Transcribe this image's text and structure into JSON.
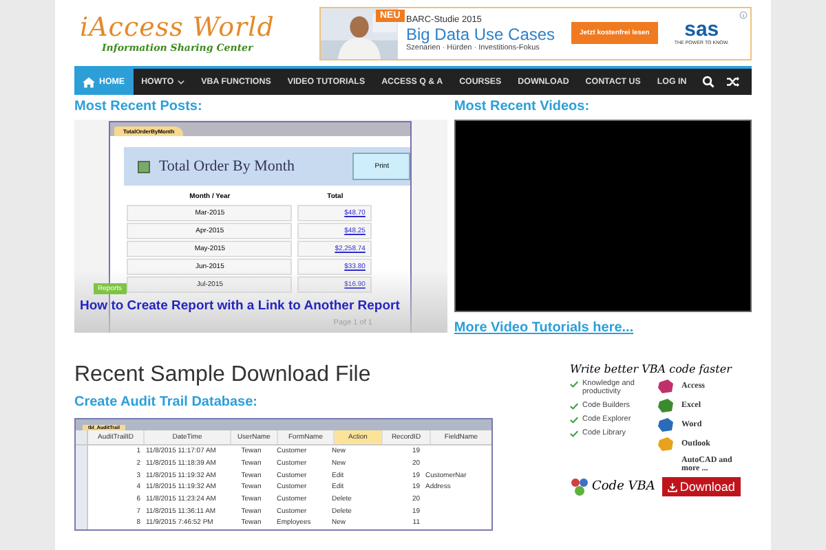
{
  "header": {
    "logo": {
      "title": "iAccess World",
      "tagline": "Information Sharing Center"
    },
    "ad": {
      "badge": "NEU",
      "eyebrow": "BARC-Studie 2015",
      "headline": "Big Data Use Cases",
      "subline": "Szenarien · Hürden · Investitions-Fokus",
      "cta": "Jetzt kostenfrei lesen",
      "brand": "sas",
      "brand_tagline": "THE POWER TO KNOW."
    }
  },
  "nav": {
    "items": [
      {
        "label": "HOME",
        "kind": "home",
        "dropdown": false,
        "selected": true
      },
      {
        "label": "HOWTO",
        "kind": "link",
        "dropdown": true,
        "selected": false
      },
      {
        "label": "VBA FUNCTIONS",
        "kind": "link",
        "dropdown": false,
        "selected": false
      },
      {
        "label": "VIDEO TUTORIALS",
        "kind": "link",
        "dropdown": false,
        "selected": false
      },
      {
        "label": "ACCESS Q & A",
        "kind": "link",
        "dropdown": false,
        "selected": false
      },
      {
        "label": "COURSES",
        "kind": "link",
        "dropdown": false,
        "selected": false
      },
      {
        "label": "DOWNLOAD",
        "kind": "link",
        "dropdown": false,
        "selected": false
      },
      {
        "label": "CONTACT US",
        "kind": "link",
        "dropdown": false,
        "selected": false
      },
      {
        "label": "LOG IN",
        "kind": "link",
        "dropdown": false,
        "selected": false
      }
    ]
  },
  "recent_posts": {
    "heading": "Most Recent Posts:",
    "post": {
      "category": "Reports",
      "title": "How to Create Report with a Link to Another Report",
      "report": {
        "tab": "TotalOrderByMonth",
        "title": "Total Order By Month",
        "button": "Print",
        "columns": [
          "Month / Year",
          "Total"
        ],
        "rows": [
          [
            "Mar-2015",
            "$48.70"
          ],
          [
            "Apr-2015",
            "$48.25"
          ],
          [
            "May-2015",
            "$2,258.74"
          ],
          [
            "Jun-2015",
            "$33.80"
          ],
          [
            "Jul-2015",
            "$16.90"
          ]
        ],
        "footer": "Page 1 of 1"
      }
    }
  },
  "recent_videos": {
    "heading": "Most Recent Videos:",
    "more_link": "More Video Tutorials here..."
  },
  "download": {
    "heading": "Recent Sample Download File",
    "subheading": "Create Audit Trail Database:",
    "table": {
      "tab": "tbl_AuditTrail",
      "columns": [
        {
          "label": "AuditTrailID",
          "selected": false
        },
        {
          "label": "DateTime",
          "selected": false
        },
        {
          "label": "UserName",
          "selected": false
        },
        {
          "label": "FormName",
          "selected": false
        },
        {
          "label": "Action",
          "selected": true
        },
        {
          "label": "RecordID",
          "selected": false
        },
        {
          "label": "FieldName",
          "selected": false
        }
      ],
      "rows": [
        [
          "1",
          "11/8/2015 11:17:07 AM",
          "Tewan",
          "Customer",
          "New",
          "19"
        ],
        [
          "2",
          "11/8/2015 11:18:39 AM",
          "Tewan",
          "Customer",
          "New",
          "20"
        ],
        [
          "3",
          "11/8/2015 11:19:32 AM",
          "Tewan",
          "Customer",
          "Edit",
          "19",
          "CustomerNar"
        ],
        [
          "4",
          "11/8/2015 11:19:32 AM",
          "Tewan",
          "Customer",
          "Edit",
          "19",
          "Address"
        ],
        [
          "6",
          "11/8/2015 11:23:24 AM",
          "Tewan",
          "Customer",
          "Delete",
          "20"
        ],
        [
          "7",
          "11/8/2015 11:36:11 AM",
          "Tewan",
          "Customer",
          "Delete",
          "19"
        ],
        [
          "8",
          "11/9/2015 7:46:52 PM",
          "Tewan",
          "Employees",
          "New",
          "11"
        ]
      ]
    }
  },
  "sidebar_ad": {
    "title": "Write better VBA code faster",
    "features": [
      "Knowledge and productivity",
      "Code Builders",
      "Code Explorer",
      "Code Library"
    ],
    "apps": [
      {
        "name": "Access",
        "color": "#c0306a"
      },
      {
        "name": "Excel",
        "color": "#3c8a2e"
      },
      {
        "name": "Word",
        "color": "#2b6cb8"
      },
      {
        "name": "Outlook",
        "color": "#e8a21c"
      },
      {
        "name": "AutoCAD and more ..."
      }
    ],
    "brand": "Code VBA",
    "button": "Download"
  }
}
